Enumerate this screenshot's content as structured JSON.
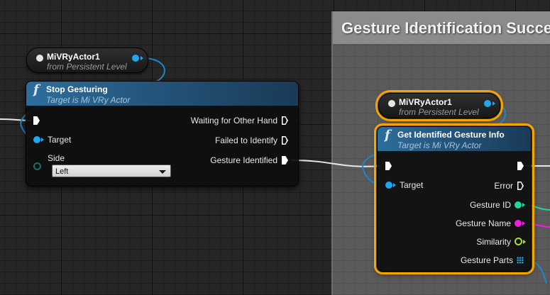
{
  "comment": {
    "title": "Gesture Identification Success"
  },
  "var_node_left": {
    "name": "MiVRyActor1",
    "subtitle": "from Persistent Level"
  },
  "var_node_right": {
    "name": "MiVRyActor1",
    "subtitle": "from Persistent Level"
  },
  "stop_gesturing": {
    "icon": "f",
    "title": "Stop Gesturing",
    "subtitle": "Target is Mi VRy Actor",
    "outputs": [
      "Waiting for Other Hand",
      "Failed to Identify",
      "Gesture Identified"
    ],
    "target_label": "Target",
    "side_label": "Side",
    "side_value": "Left"
  },
  "get_gesture_info": {
    "icon": "f",
    "title": "Get Identified Gesture Info",
    "subtitle": "Target is Mi VRy Actor",
    "target_label": "Target",
    "outputs": [
      "Error",
      "Gesture ID",
      "Gesture Name",
      "Similarity",
      "Gesture Parts"
    ]
  },
  "colors": {
    "object_pin": "#1fa6f0",
    "int_pin": "#1ed6a0",
    "string_pin": "#ee1ee0",
    "float_pin": "#a6e32c",
    "selection": "#f5a300",
    "function_header": "#2d6e9c"
  }
}
